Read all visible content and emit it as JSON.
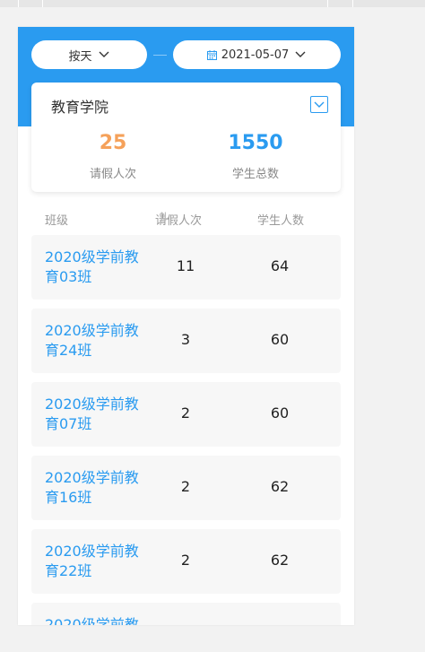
{
  "filters": {
    "period_label": "按天",
    "date_label": "2021-05-07"
  },
  "summary": {
    "college_name": "教育学院",
    "leave_count": "25",
    "leave_label": "请假人次",
    "student_total": "1550",
    "student_total_label": "学生总数"
  },
  "table": {
    "headers": {
      "class": "班级",
      "leave": "请假人次",
      "sort_symbol": "⇅",
      "students": "学生人数"
    },
    "rows": [
      {
        "class_name": "2020级学前教育03班",
        "leave": "11",
        "students": "64"
      },
      {
        "class_name": "2020级学前教育24班",
        "leave": "3",
        "students": "60"
      },
      {
        "class_name": "2020级学前教育07班",
        "leave": "2",
        "students": "60"
      },
      {
        "class_name": "2020级学前教育16班",
        "leave": "2",
        "students": "62"
      },
      {
        "class_name": "2020级学前教育22班",
        "leave": "2",
        "students": "62"
      },
      {
        "class_name": "2020级学前教",
        "leave": "",
        "students": ""
      }
    ]
  },
  "icons": {
    "period_dropdown": "chevron-down-icon",
    "date_calendar": "calendar-icon",
    "date_dropdown": "chevron-down-icon",
    "college_toggle": "chevron-down-icon"
  },
  "colors": {
    "accent": "#2a9bf0",
    "leave_number": "#f5a15a",
    "total_number": "#2a9bf0"
  }
}
